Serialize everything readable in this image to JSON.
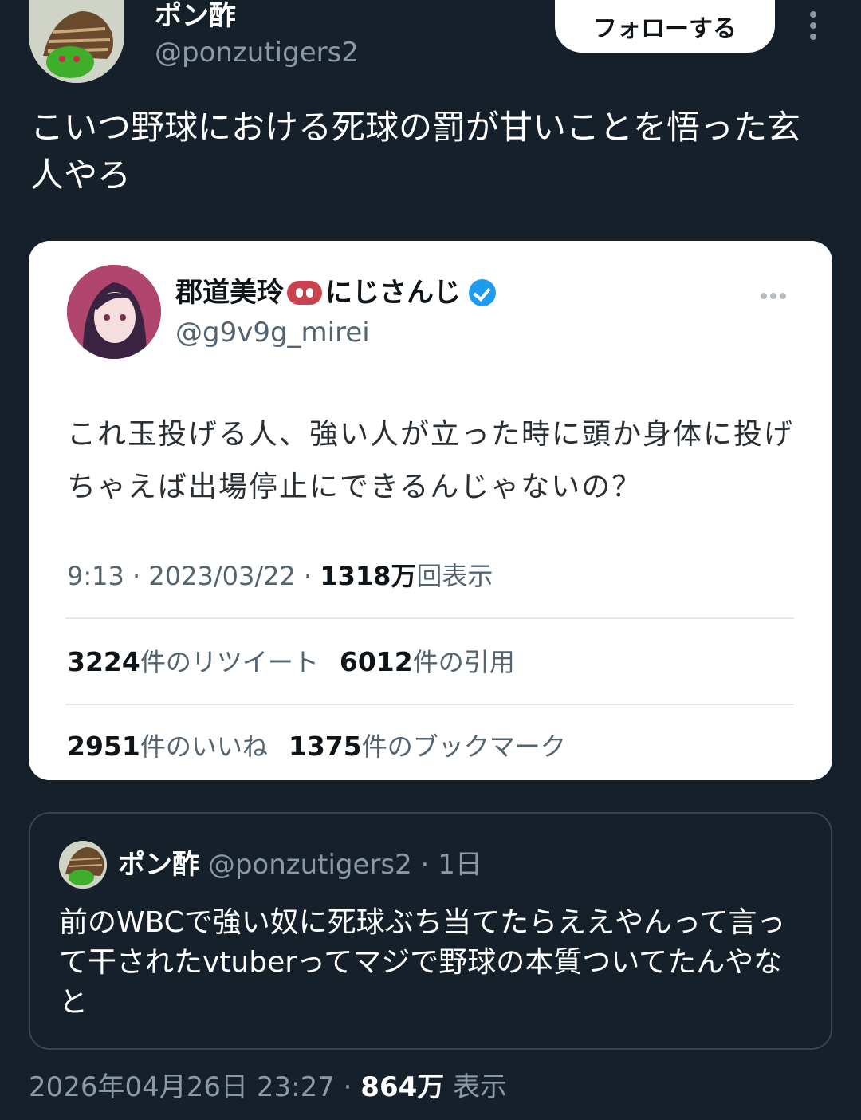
{
  "header": {
    "display_name": "ポン酢",
    "handle": "@ponzutigers2",
    "follow_label": "フォローする"
  },
  "post": {
    "text": "こいつ野球における死球の罰が甘いことを悟った玄人やろ"
  },
  "quoted_card": {
    "display_name": "郡道美玲",
    "affiliation": "にじさんじ",
    "handle": "@g9v9g_mirei",
    "text": "これ玉投げる人、強い人が立った時に頭か身体に投げちゃえば出場停止にできるんじゃないの？",
    "time": "9:13",
    "date": "2023/03/22",
    "views_num": "1318万",
    "views_label": "回表示",
    "retweets_num": "3224",
    "retweets_label": "件のリツイート",
    "quotes_num": "6012",
    "quotes_label": "件の引用",
    "likes_num": "2951",
    "likes_label": "件のいいね",
    "bookmarks_num": "1375",
    "bookmarks_label": "件のブックマーク"
  },
  "quote_post": {
    "display_name": "ポン酢",
    "handle": "@ponzutigers2",
    "age": "1日",
    "text": "前のWBCで強い奴に死球ぶち当てたらええやんって言って干されたvtuberってマジで野球の本質ついてたんやなと"
  },
  "footer": {
    "datetime": "2026年04月26日 23:27",
    "views_num": "864万",
    "views_label": "表示"
  },
  "icons": {
    "verified": "verified-badge-icon",
    "more_vertical": "more-vertical-icon",
    "more_horizontal": "more-horizontal-icon",
    "pig": "pig-nose-icon"
  },
  "colors": {
    "background": "#15202b",
    "card": "#ffffff",
    "verified_blue": "#1d9bf0",
    "muted_text": "#8b98a5"
  }
}
